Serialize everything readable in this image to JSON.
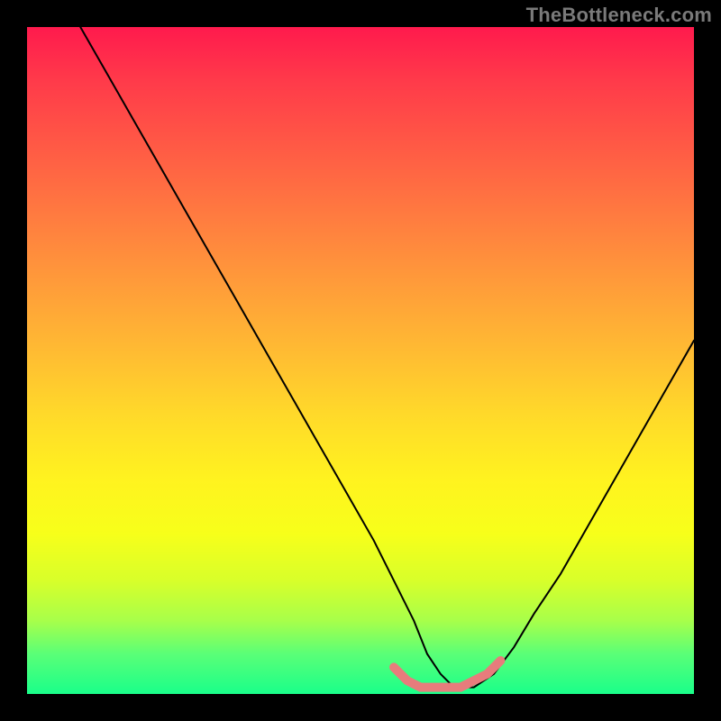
{
  "watermark": "TheBottleneck.com",
  "chart_data": {
    "type": "line",
    "title": "",
    "xlabel": "",
    "ylabel": "",
    "xlim": [
      0,
      100
    ],
    "ylim": [
      0,
      100
    ],
    "grid": false,
    "legend": false,
    "series": [
      {
        "name": "curve",
        "color": "#000000",
        "stroke_width": 2,
        "x": [
          8,
          12,
          16,
          20,
          24,
          28,
          32,
          36,
          40,
          44,
          48,
          52,
          55,
          58,
          60,
          62,
          64,
          67,
          70,
          73,
          76,
          80,
          84,
          88,
          92,
          96,
          100
        ],
        "y": [
          100,
          93,
          86,
          79,
          72,
          65,
          58,
          51,
          44,
          37,
          30,
          23,
          17,
          11,
          6,
          3,
          1,
          1,
          3,
          7,
          12,
          18,
          25,
          32,
          39,
          46,
          53
        ]
      },
      {
        "name": "highlight-band",
        "color": "#e77c7c",
        "stroke_width": 10,
        "x": [
          55,
          57,
          59,
          61,
          63,
          65,
          67,
          69,
          71
        ],
        "y": [
          4,
          2,
          1,
          1,
          1,
          1,
          2,
          3,
          5
        ]
      }
    ],
    "background_gradient": {
      "top": "#ff1a4d",
      "bottom": "#1aff8a"
    }
  }
}
